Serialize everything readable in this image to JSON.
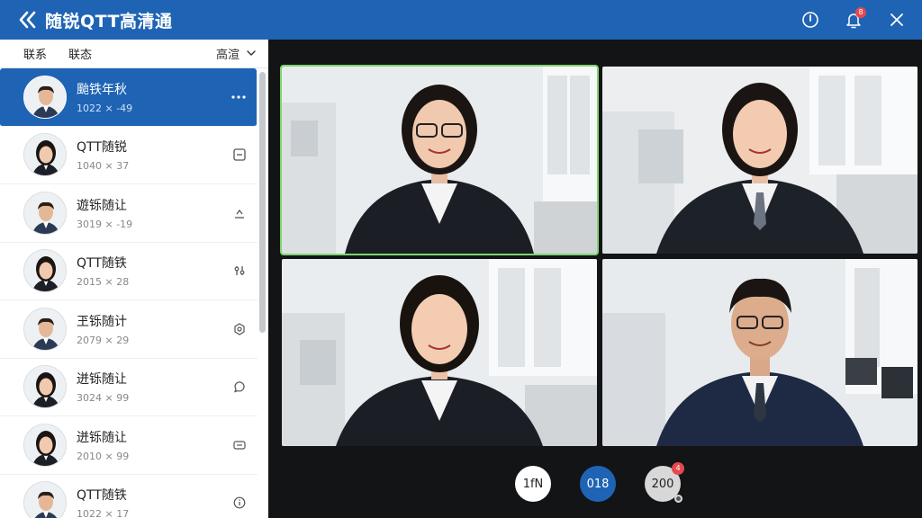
{
  "window": {
    "title": "随锐QTT高清通",
    "notification_badge": "8"
  },
  "sidebar": {
    "tabs": [
      "联系",
      "联态"
    ],
    "quality_label": "高渲",
    "contacts": [
      {
        "name": "颱铁年秋",
        "sub": "1022 ⨯ -49",
        "action_icon": "more-icon",
        "active": true
      },
      {
        "name": "QTT随锐",
        "sub": "1040 ⨯ 37",
        "action_icon": "window-icon",
        "active": false
      },
      {
        "name": "遊铄随让",
        "sub": "3019 ⨯ -19",
        "action_icon": "share-icon",
        "active": false
      },
      {
        "name": "QTT随铁",
        "sub": "2015 ⨯ 28",
        "action_icon": "settings-icon",
        "active": false
      },
      {
        "name": "玊铄随计",
        "sub": "2079 ⨯ 29",
        "action_icon": "camera-icon",
        "active": false
      },
      {
        "name": "迸铄随让",
        "sub": "3024 ⨯ 99",
        "action_icon": "chat-icon",
        "active": false
      },
      {
        "name": "迸铄随让",
        "sub": "2010 ⨯ 99",
        "action_icon": "keyboard-icon",
        "active": false
      },
      {
        "name": "QTT随铁",
        "sub": "1022 ⨯ 17",
        "action_icon": "info-icon",
        "active": false
      }
    ]
  },
  "controls": {
    "btn1": "1fN",
    "btn2": "018",
    "btn3": "200",
    "btn3_badge": "4"
  }
}
